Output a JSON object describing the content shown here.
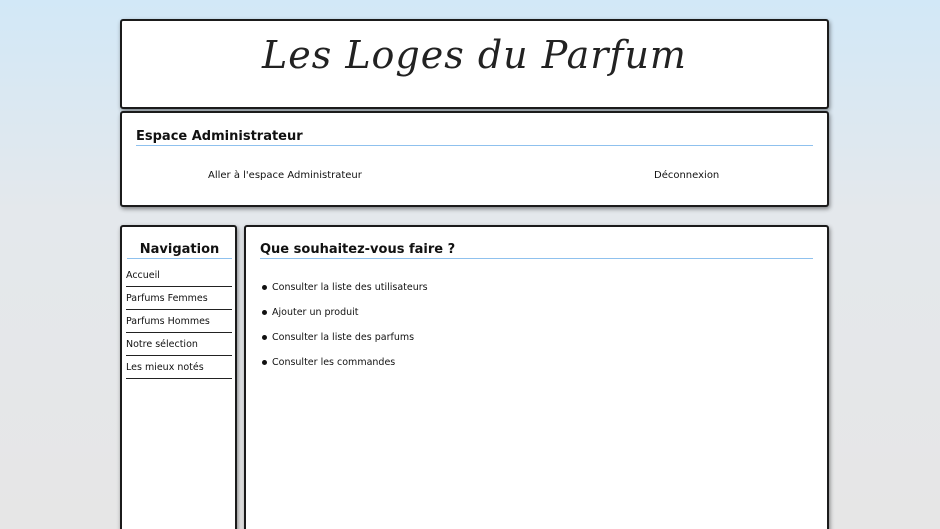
{
  "header": {
    "site_title": "Les Loges du Parfum"
  },
  "admin": {
    "title": "Espace Administrateur",
    "go_link": "Aller à l'espace Administrateur",
    "logout_link": "Déconnexion"
  },
  "navigation": {
    "title": "Navigation",
    "items": [
      {
        "label": "Accueil"
      },
      {
        "label": "Parfums Femmes"
      },
      {
        "label": "Parfums Hommes"
      },
      {
        "label": "Notre sélection"
      },
      {
        "label": "Les mieux notés"
      }
    ]
  },
  "main": {
    "title": "Que souhaitez-vous faire ?",
    "actions": [
      {
        "label": "Consulter la liste des utilisateurs"
      },
      {
        "label": "Ajouter un produit"
      },
      {
        "label": "Consulter la liste des parfums"
      },
      {
        "label": "Consulter les commandes"
      }
    ]
  },
  "colors": {
    "title_underline": "#8fc1ee",
    "box_border": "#1b1b1b",
    "background_top": "#d2e8f7",
    "background_bottom": "#e6e6e6"
  }
}
